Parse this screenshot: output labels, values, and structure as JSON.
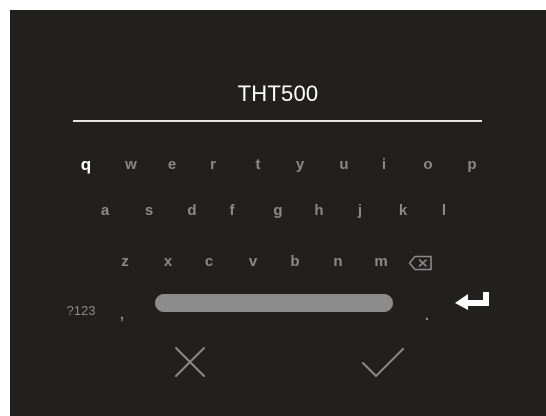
{
  "input": {
    "value": "THT500"
  },
  "keyboard": {
    "row1": [
      "q",
      "w",
      "e",
      "r",
      "t",
      "y",
      "u",
      "i",
      "o",
      "p"
    ],
    "row2": [
      "a",
      "s",
      "d",
      "f",
      "g",
      "h",
      "j",
      "k",
      "l"
    ],
    "row3": [
      "z",
      "x",
      "c",
      "v",
      "b",
      "n",
      "m"
    ],
    "symbols_label": "?123",
    "comma_label": ",",
    "period_label": "."
  },
  "icons": {
    "backspace": "backspace-icon",
    "enter": "enter-icon",
    "cancel": "close-icon",
    "confirm": "checkmark-icon"
  },
  "colors": {
    "background": "#221f1f",
    "text_active": "#ffffff",
    "key_inactive": "#8a8a8a",
    "spacebar": "#8c8c8c"
  }
}
